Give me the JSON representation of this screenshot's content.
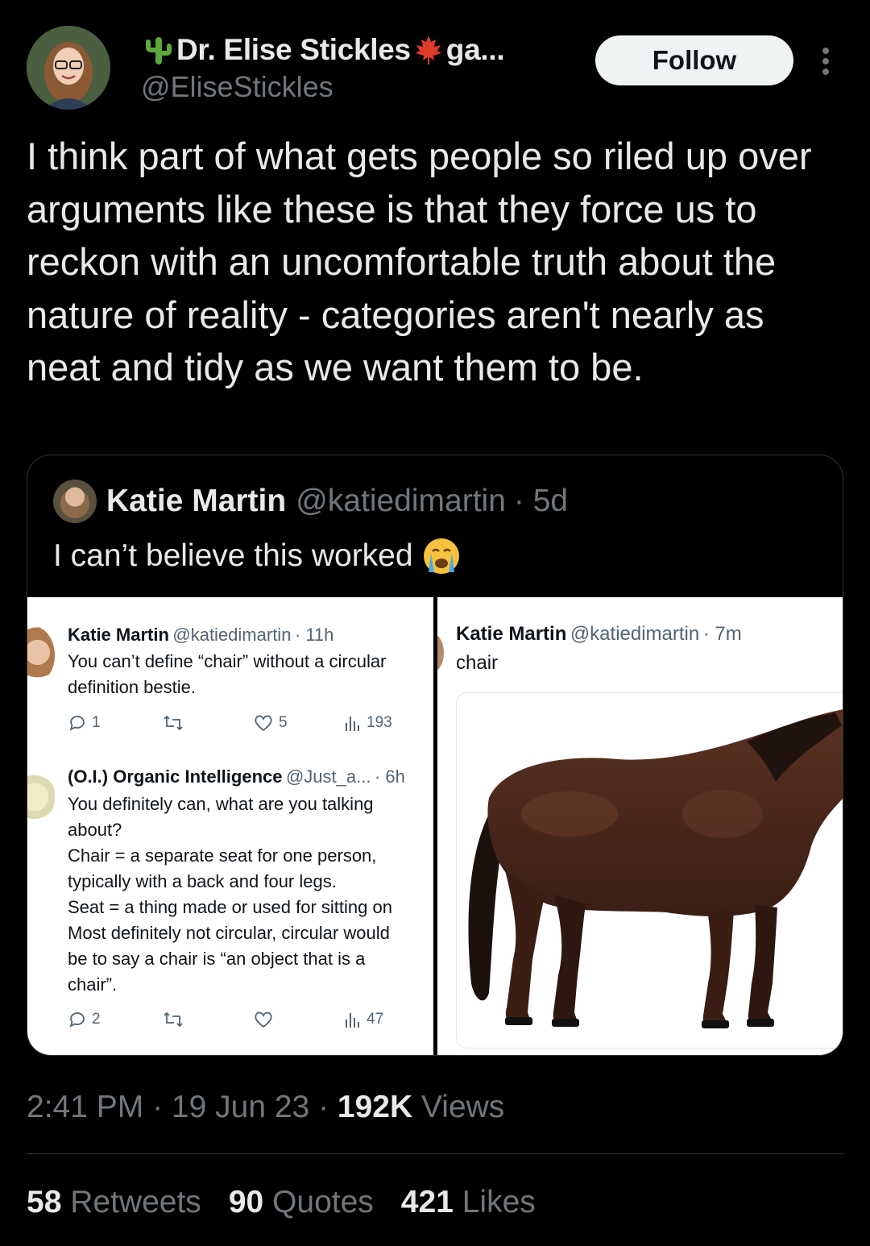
{
  "author": {
    "display_name": "Dr. Elise Stickles",
    "name_suffix": "ga...",
    "handle": "@EliseStickles",
    "follow_label": "Follow"
  },
  "tweet": {
    "text": "I think part of what gets people so riled up over arguments like these is that they force us to reckon with an uncomfortable truth about the nature of reality - categories aren't nearly as neat and tidy as we want them to be.",
    "time": "2:41 PM",
    "date": "19 Jun 23",
    "views_count": "192K",
    "views_label": "Views",
    "retweets_count": "58",
    "retweets_label": "Retweets",
    "quotes_count": "90",
    "quotes_label": "Quotes",
    "likes_count": "421",
    "likes_label": "Likes"
  },
  "quoted": {
    "name": "Katie Martin",
    "handle": "@katiedimartin",
    "age": "· 5d",
    "text": "I can’t believe this worked",
    "left_image": {
      "tweet1": {
        "name": "Katie Martin",
        "handle": "@katiedimartin",
        "age": "· 11h",
        "line1": "You can’t define “chair” without a circular",
        "line2": "definition bestie.",
        "replies": "1",
        "likes": "5",
        "views": "193"
      },
      "tweet2": {
        "name": "(O.I.) Organic Intelligence",
        "handle": "@Just_a...",
        "age": "· 6h",
        "lines": [
          "You definitely can, what are you talking",
          "about?",
          "Chair = a separate seat for one person,",
          "typically with a back and four legs.",
          "Seat = a thing made or used for sitting on",
          "Most definitely not circular, circular would",
          "be to say a chair is “an object that is a",
          "chair”."
        ],
        "replies": "2",
        "views": "47"
      }
    },
    "right_image": {
      "name": "Katie Martin",
      "handle": "@katiedimartin",
      "age": "· 7m",
      "text": "chair"
    }
  },
  "colors": {
    "background": "#000000",
    "text_primary": "#e7e9ea",
    "text_secondary": "#71767b",
    "divider": "#2f3336"
  },
  "icons": [
    "cactus-emoji",
    "maple-leaf-emoji",
    "more-icon",
    "crying-face-emoji",
    "reply-icon",
    "retweet-icon",
    "like-icon",
    "views-icon"
  ]
}
